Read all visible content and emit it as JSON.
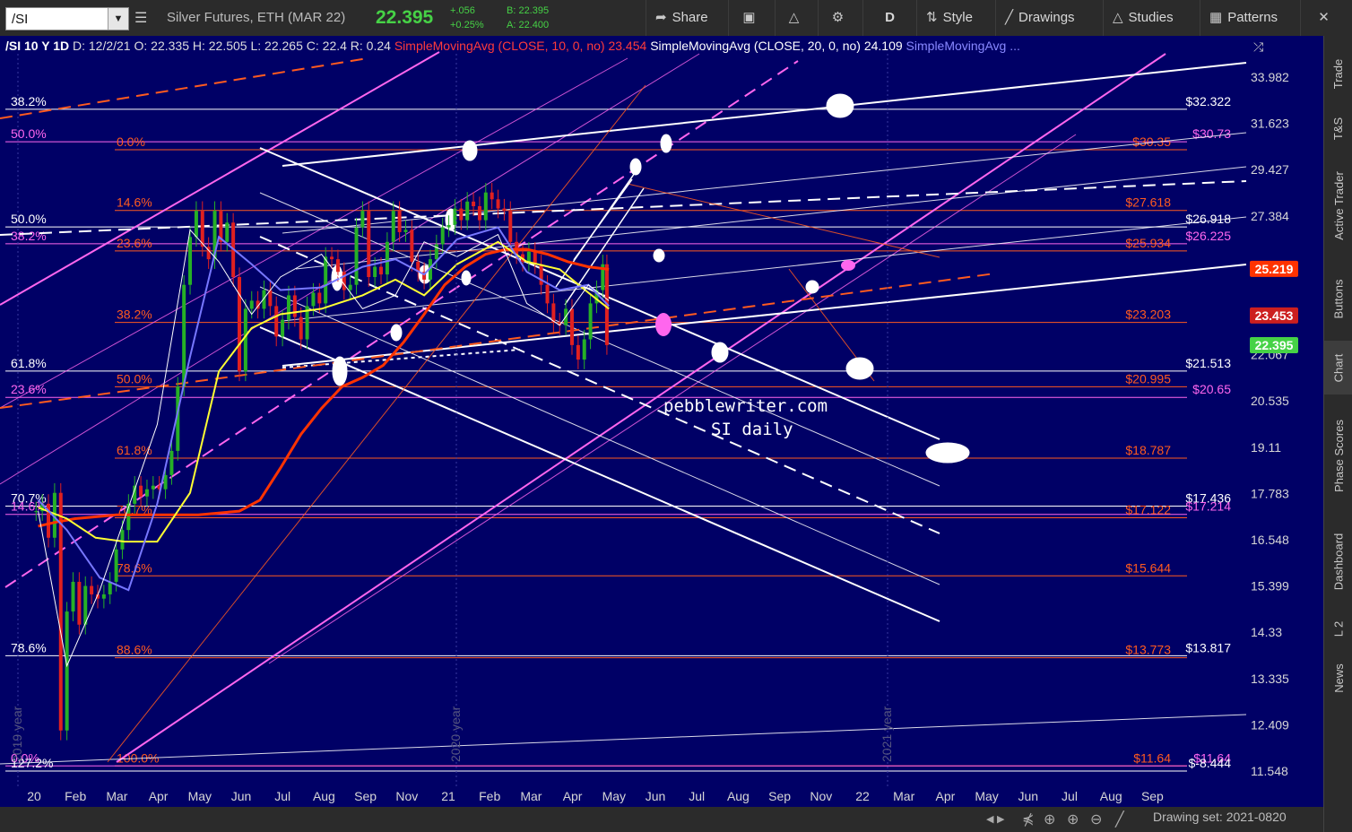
{
  "toolbar": {
    "symbol": "/SI",
    "description": "Silver Futures, ETH (MAR 22)",
    "last": "22.395",
    "change": "+.056",
    "change_pct": "+0.25%",
    "bid": "B: 22.395",
    "ask": "A: 22.400",
    "buttons": [
      {
        "icon": "share-icon",
        "label": "Share"
      },
      {
        "icon": "camera-icon",
        "label": ""
      },
      {
        "icon": "flask-icon",
        "label": ""
      },
      {
        "icon": "gear-icon",
        "label": ""
      },
      {
        "icon": "period-icon",
        "label": "D"
      },
      {
        "icon": "style-icon",
        "label": "Style"
      },
      {
        "icon": "pencil-icon",
        "label": "Drawings"
      },
      {
        "icon": "flask-icon",
        "label": "Studies"
      },
      {
        "icon": "pattern-icon",
        "label": "Patterns"
      }
    ]
  },
  "header": {
    "symbol_period": "/SI 10 Y 1D",
    "date": "D: 12/2/21",
    "open": "O: 22.335",
    "high": "H: 22.505",
    "low": "L: 22.265",
    "close": "C: 22.4",
    "range": "R: 0.24",
    "sma10_label": "SimpleMovingAvg (CLOSE, 10, 0, no)",
    "sma10_value": "23.454",
    "sma20_label": "SimpleMovingAvg (CLOSE, 20, 0, no)",
    "sma20_value": "24.109",
    "sma3_label": "SimpleMovingAvg ..."
  },
  "colors": {
    "background": "#000066",
    "white_fib": "#ffffff",
    "orange_fib": "#ff5a1f",
    "pink_fib": "#ff66ee",
    "sma10": "#ffffff",
    "sma20": "#7777ff",
    "sma50": "#ffff33",
    "sma200": "#ff3300",
    "up": "#26b026",
    "down": "#e02020",
    "last_price": "#46d246"
  },
  "chart_data": {
    "type": "candlestick",
    "title": "/SI 10 Y 1D",
    "y_range": [
      11.3,
      35.1
    ],
    "y_ticks": [
      33.982,
      31.623,
      29.427,
      27.384,
      25.482,
      23.714,
      22.067,
      20.535,
      19.11,
      17.783,
      16.548,
      15.399,
      14.33,
      13.335,
      12.409,
      11.548
    ],
    "y_tick_labels": [
      "33.982",
      "31.623",
      "29.427",
      "27.384",
      "",
      "",
      "22.067",
      "20.535",
      "19.11",
      "17.783",
      "16.548",
      "15.399",
      "14.33",
      "13.335",
      "12.409",
      "11.548"
    ],
    "x_labels": [
      "20",
      "Feb",
      "Mar",
      "Apr",
      "May",
      "Jun",
      "Jul",
      "Aug",
      "Sep",
      "Nov",
      "21",
      "Feb",
      "Mar",
      "Apr",
      "May",
      "Jun",
      "Jul",
      "Aug",
      "Sep",
      "Nov",
      "22",
      "Mar",
      "Apr",
      "May",
      "Jun",
      "Jul",
      "Aug",
      "Sep"
    ],
    "year_markers": [
      "2019 year",
      "2020 year",
      "2021 year"
    ],
    "price_badges": [
      {
        "value": "25.219",
        "color": "#ff3300"
      },
      {
        "value": "23.453",
        "color": "#cc1f1f"
      },
      {
        "value": "22.395",
        "color": "#46d246"
      }
    ],
    "fib_levels": [
      {
        "price": 32.322,
        "left": "38.2%",
        "right": "$32.322",
        "color": "#ffffff"
      },
      {
        "price": 30.73,
        "left": "50.0%",
        "right": "$30.73",
        "color": "#ff66ee"
      },
      {
        "price": 30.35,
        "left": "0.0%",
        "right": "$30.35",
        "color": "#ff5a1f"
      },
      {
        "price": 27.618,
        "left": "14.6%",
        "right": "$27.618",
        "color": "#ff5a1f"
      },
      {
        "price": 26.918,
        "left": "50.0%",
        "right": "$26.918",
        "color": "#ffffff"
      },
      {
        "price": 26.225,
        "left": "38.2%",
        "right": "$26.225",
        "color": "#ff66ee"
      },
      {
        "price": 25.934,
        "left": "23.6%",
        "right": "$25.934",
        "color": "#ff5a1f"
      },
      {
        "price": 23.203,
        "left": "38.2%",
        "right": "$23.203",
        "color": "#ff5a1f"
      },
      {
        "price": 21.513,
        "left": "61.8%",
        "right": "$21.513",
        "color": "#ffffff"
      },
      {
        "price": 20.995,
        "left": "50.0%",
        "right": "$20.995",
        "color": "#ff5a1f"
      },
      {
        "price": 20.65,
        "left": "23.6%",
        "right": "$20.65",
        "color": "#ff66ee"
      },
      {
        "price": 18.787,
        "left": "61.8%",
        "right": "$18.787",
        "color": "#ff5a1f"
      },
      {
        "price": 17.436,
        "left": "70.7%",
        "right": "$17.436",
        "color": "#ffffff"
      },
      {
        "price": 17.214,
        "left": "14.6%",
        "right": "$17.214",
        "color": "#ff66ee"
      },
      {
        "price": 17.122,
        "left": "70.7%",
        "right": "$17.122",
        "color": "#ff5a1f"
      },
      {
        "price": 15.644,
        "left": "78.6%",
        "right": "$15.644",
        "color": "#ff5a1f"
      },
      {
        "price": 13.817,
        "left": "78.6%",
        "right": "$13.817",
        "color": "#ffffff"
      },
      {
        "price": 13.773,
        "left": "88.6%",
        "right": "$13.773",
        "color": "#ff5a1f"
      },
      {
        "price": 11.64,
        "left": "100.0%",
        "right": "$11.64",
        "color": "#ff5a1f"
      },
      {
        "price": 11.64,
        "left": "0.0%",
        "right": "$11.64",
        "color": "#ff66ee"
      },
      {
        "price": 11.548,
        "left": "127.2%",
        "right": "$-8.444",
        "color": "#ffffff"
      }
    ],
    "sma200": [
      [
        17.1,
        16.9
      ],
      [
        17.5,
        17.0
      ],
      [
        18.0,
        17.1
      ],
      [
        19.0,
        17.2
      ],
      [
        20.0,
        17.2
      ],
      [
        21.0,
        17.2
      ],
      [
        22.0,
        17.3
      ],
      [
        22.5,
        17.6
      ],
      [
        23.0,
        18.5
      ],
      [
        23.5,
        19.5
      ],
      [
        24.0,
        20.3
      ],
      [
        24.5,
        21.0
      ],
      [
        25.0,
        21.3
      ],
      [
        25.5,
        21.7
      ],
      [
        26.0,
        22.5
      ],
      [
        26.5,
        23.5
      ],
      [
        27.0,
        24.6
      ],
      [
        27.5,
        25.3
      ],
      [
        28.0,
        25.8
      ],
      [
        28.5,
        26.0
      ],
      [
        29.0,
        26.0
      ],
      [
        29.5,
        25.8
      ],
      [
        30.0,
        25.5
      ],
      [
        30.5,
        25.3
      ],
      [
        31.0,
        25.2
      ]
    ],
    "sma50": [
      [
        17.1,
        17.4
      ],
      [
        17.8,
        17.1
      ],
      [
        18.5,
        16.6
      ],
      [
        19.2,
        16.5
      ],
      [
        20.0,
        16.5
      ],
      [
        20.8,
        17.8
      ],
      [
        21.5,
        21.5
      ],
      [
        22.3,
        23.0
      ],
      [
        23.0,
        23.5
      ],
      [
        24.0,
        23.7
      ],
      [
        25.0,
        24.2
      ],
      [
        25.8,
        24.8
      ],
      [
        26.5,
        24.2
      ],
      [
        27.3,
        25.4
      ],
      [
        28.3,
        26.3
      ],
      [
        29.0,
        25.5
      ],
      [
        29.8,
        25.2
      ],
      [
        30.5,
        24.3
      ],
      [
        31.0,
        23.7
      ]
    ],
    "sma20": [
      [
        17.1,
        17.6
      ],
      [
        17.8,
        16.8
      ],
      [
        18.6,
        15.6
      ],
      [
        19.3,
        15.3
      ],
      [
        20.0,
        17.5
      ],
      [
        20.8,
        22.0
      ],
      [
        21.5,
        26.5
      ],
      [
        22.3,
        25.4
      ],
      [
        23.0,
        24.4
      ],
      [
        24.0,
        24.5
      ],
      [
        25.0,
        25.3
      ],
      [
        25.8,
        25.6
      ],
      [
        26.5,
        25.0
      ],
      [
        27.3,
        26.4
      ],
      [
        28.3,
        26.9
      ],
      [
        29.0,
        25.1
      ],
      [
        29.8,
        24.4
      ],
      [
        30.5,
        24.6
      ],
      [
        31.0,
        23.8
      ]
    ],
    "sma10": [
      [
        17.1,
        17.3
      ],
      [
        17.8,
        13.6
      ],
      [
        18.6,
        15.3
      ],
      [
        19.3,
        17.4
      ],
      [
        20.0,
        19.8
      ],
      [
        20.8,
        26.8
      ],
      [
        21.5,
        25.5
      ],
      [
        22.3,
        23.5
      ],
      [
        23.0,
        24.9
      ],
      [
        24.0,
        25.8
      ],
      [
        25.0,
        23.7
      ],
      [
        25.8,
        24.2
      ],
      [
        26.5,
        26.3
      ],
      [
        27.3,
        25.7
      ],
      [
        28.3,
        26.6
      ],
      [
        29.0,
        23.9
      ],
      [
        29.8,
        23.1
      ],
      [
        30.5,
        24.6
      ],
      [
        31.0,
        24.0
      ]
    ],
    "candles": [
      [
        17.05,
        17.3
      ],
      [
        17.2,
        17.5
      ],
      [
        17.35,
        16.6
      ],
      [
        17.5,
        17.8
      ],
      [
        17.65,
        12.3
      ],
      [
        17.8,
        14.8
      ],
      [
        17.95,
        15.5
      ],
      [
        18.1,
        14.5
      ],
      [
        18.25,
        15.4
      ],
      [
        18.4,
        15.2
      ],
      [
        18.55,
        15.1
      ],
      [
        18.7,
        15.2
      ],
      [
        18.85,
        15.5
      ],
      [
        19.0,
        16.3
      ],
      [
        19.15,
        16.8
      ],
      [
        19.3,
        17.5
      ],
      [
        19.45,
        18.0
      ],
      [
        19.6,
        17.7
      ],
      [
        19.75,
        17.9
      ],
      [
        19.9,
        18.0
      ],
      [
        20.05,
        17.9
      ],
      [
        20.2,
        18.3
      ],
      [
        20.35,
        19.0
      ],
      [
        20.5,
        21.0
      ],
      [
        20.65,
        24.6
      ],
      [
        20.8,
        26.5
      ],
      [
        20.95,
        27.6
      ],
      [
        21.1,
        26.1
      ],
      [
        21.25,
        25.6
      ],
      [
        21.4,
        27.6
      ],
      [
        21.55,
        26.3
      ],
      [
        21.7,
        27.1
      ],
      [
        21.85,
        24.9
      ],
      [
        22.0,
        21.5
      ],
      [
        22.15,
        23.7
      ],
      [
        22.3,
        24.0
      ],
      [
        22.45,
        23.7
      ],
      [
        22.6,
        24.4
      ],
      [
        22.75,
        23.8
      ],
      [
        22.9,
        22.7
      ],
      [
        23.05,
        23.3
      ],
      [
        23.2,
        24.2
      ],
      [
        23.35,
        23.4
      ],
      [
        23.5,
        22.6
      ],
      [
        23.65,
        23.8
      ],
      [
        23.8,
        24.3
      ],
      [
        23.95,
        23.9
      ],
      [
        24.1,
        25.7
      ],
      [
        24.25,
        25.6
      ],
      [
        24.4,
        25.1
      ],
      [
        24.55,
        24.4
      ],
      [
        24.7,
        24.6
      ],
      [
        24.85,
        26.9
      ],
      [
        25.0,
        27.6
      ],
      [
        25.15,
        24.9
      ],
      [
        25.3,
        25.3
      ],
      [
        25.45,
        25.0
      ],
      [
        25.6,
        26.3
      ],
      [
        25.75,
        27.6
      ],
      [
        25.9,
        26.7
      ],
      [
        26.05,
        26.8
      ],
      [
        26.2,
        25.5
      ],
      [
        26.35,
        25.1
      ],
      [
        26.5,
        24.8
      ],
      [
        26.65,
        25.6
      ],
      [
        26.8,
        26.2
      ],
      [
        26.95,
        26.9
      ],
      [
        27.1,
        27.0
      ],
      [
        27.25,
        27.7
      ],
      [
        27.4,
        27.2
      ],
      [
        27.55,
        28.0
      ],
      [
        27.7,
        27.8
      ],
      [
        27.85,
        27.2
      ],
      [
        28.0,
        28.4
      ],
      [
        28.15,
        28.1
      ],
      [
        28.3,
        27.7
      ],
      [
        28.45,
        27.6
      ],
      [
        28.6,
        26.3
      ],
      [
        28.75,
        25.8
      ],
      [
        28.9,
        25.5
      ],
      [
        29.05,
        25.9
      ],
      [
        29.2,
        25.4
      ],
      [
        29.35,
        24.6
      ],
      [
        29.5,
        23.9
      ],
      [
        29.65,
        23.2
      ],
      [
        29.8,
        23.1
      ],
      [
        29.95,
        23.7
      ],
      [
        30.1,
        22.4
      ],
      [
        30.25,
        21.9
      ],
      [
        30.4,
        22.6
      ],
      [
        30.55,
        23.9
      ],
      [
        30.7,
        24.4
      ],
      [
        30.85,
        25.4
      ],
      [
        30.95,
        22.4
      ]
    ],
    "annotations": [
      {
        "text": "pebblewriter.com"
      },
      {
        "text": "SI daily"
      }
    ]
  },
  "right_tabs": [
    "Trade",
    "T&S",
    "Active Trader",
    "Buttons",
    "Chart",
    "Phase Scores",
    "Dashboard",
    "L 2",
    "News"
  ],
  "bottom_bar": {
    "drawing_set": "Drawing set: 2021-0820",
    "icons": [
      "scroll-left-icon",
      "scroll-right-icon",
      "crosshair-icon",
      "zoom-in-icon",
      "zoom-out-icon",
      "ruler-icon"
    ]
  }
}
